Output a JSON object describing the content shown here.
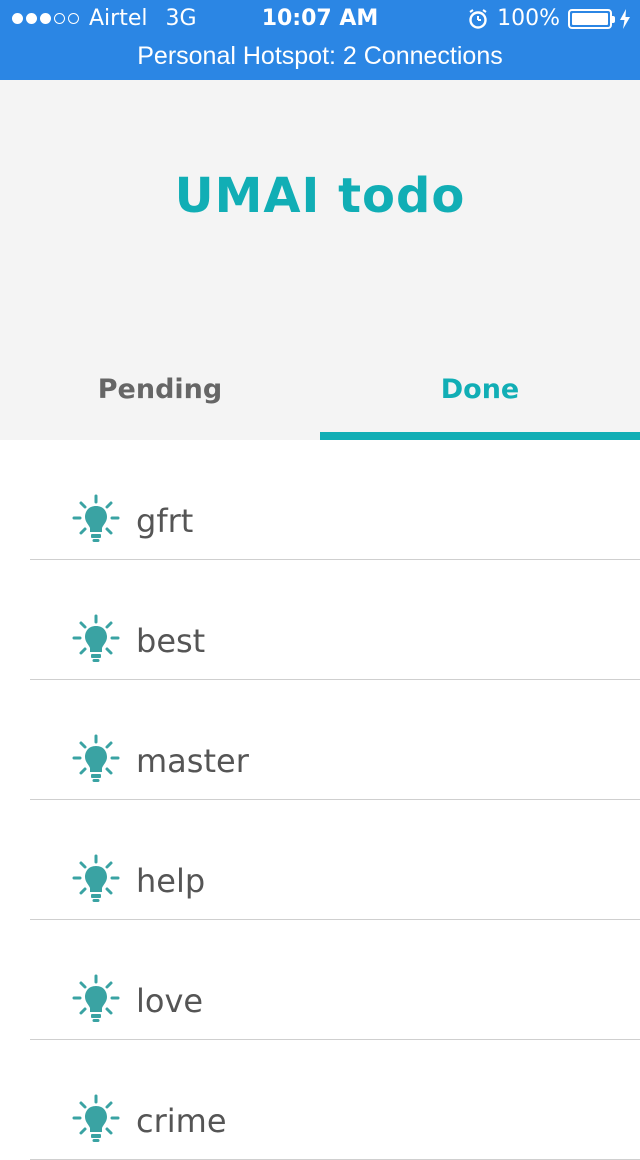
{
  "status_bar": {
    "carrier": "Airtel",
    "network": "3G",
    "time": "10:07 AM",
    "battery": "100%",
    "battery_level": 1.0,
    "hotspot": "Personal Hotspot: 2 Connections"
  },
  "header": {
    "title": "UMAI todo"
  },
  "tabs": [
    {
      "label": "Pending",
      "active": false
    },
    {
      "label": "Done",
      "active": true
    }
  ],
  "items": [
    {
      "label": "gfrt",
      "icon": "lightbulb-icon"
    },
    {
      "label": "best",
      "icon": "lightbulb-icon"
    },
    {
      "label": "master",
      "icon": "lightbulb-icon"
    },
    {
      "label": "help",
      "icon": "lightbulb-icon"
    },
    {
      "label": "love",
      "icon": "lightbulb-icon"
    },
    {
      "label": "crime",
      "icon": "lightbulb-icon"
    }
  ],
  "colors": {
    "status_bar": "#2b86e4",
    "accent": "#11aeb5",
    "header_bg": "#f4f4f4",
    "text_gray": "#555555"
  }
}
